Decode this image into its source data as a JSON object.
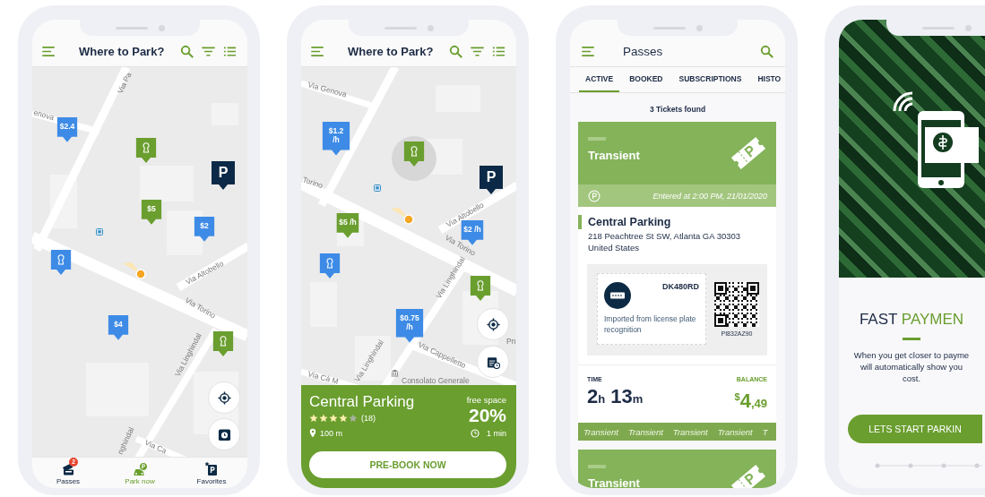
{
  "phones": [
    {
      "kind": "map",
      "header": {
        "title": "Where to Park?"
      },
      "map": {
        "streets": [
          "Via Pa",
          "enova",
          "Via Altobello",
          "Via Torino",
          "Via Linghindal",
          "nghindal",
          "Via Ca"
        ],
        "pins": [
          {
            "kind": "price",
            "label": "$2.4",
            "color": "#3d8be6",
            "selected": false
          },
          {
            "kind": "lock",
            "color": "#6a9e2f",
            "selected": false
          },
          {
            "kind": "parking",
            "label": "P",
            "color": "#0c2a47",
            "selected": false
          },
          {
            "kind": "price",
            "label": "$5",
            "color": "#6a9e2f",
            "selected": false
          },
          {
            "kind": "price",
            "label": "$2",
            "color": "#3d8be6",
            "selected": false
          },
          {
            "kind": "lock",
            "color": "#3d8be6",
            "selected": false
          },
          {
            "kind": "price",
            "label": "$4",
            "color": "#3d8be6",
            "selected": false
          },
          {
            "kind": "lock",
            "color": "#6a9e2f",
            "selected": false
          }
        ]
      },
      "nav": [
        {
          "label": "Passes",
          "badge": "2",
          "selected": false
        },
        {
          "label": "Park now",
          "selected": true
        },
        {
          "label": "Favorites",
          "selected": false
        }
      ]
    },
    {
      "kind": "map",
      "header": {
        "title": "Where to Park?"
      },
      "map": {
        "streets": [
          "Via Genova",
          "Torino",
          "Via Altobello",
          "Via Torino",
          "Via Linghindal",
          "Via Linghindal",
          "Via Cappelletto",
          "Via Cà M",
          "Consolato Generale",
          "Pn"
        ],
        "pins": [
          {
            "kind": "price",
            "label": "$1.2 /h",
            "color": "#3d8be6",
            "selected": false
          },
          {
            "kind": "lock",
            "color": "#6a9e2f",
            "selected": true
          },
          {
            "kind": "parking",
            "label": "P",
            "color": "#0c2a47",
            "selected": false
          },
          {
            "kind": "price",
            "label": "$5 /h",
            "color": "#6a9e2f",
            "selected": false
          },
          {
            "kind": "price",
            "label": "$2 /h",
            "color": "#3d8be6",
            "selected": false
          },
          {
            "kind": "lock",
            "color": "#3d8be6",
            "selected": false
          },
          {
            "kind": "lock",
            "color": "#6a9e2f",
            "selected": false
          },
          {
            "kind": "price",
            "label": "$0.75 /h",
            "color": "#3d8be6",
            "selected": false
          }
        ]
      },
      "card": {
        "name": "Central Parking",
        "stars": 4,
        "reviews": "(18)",
        "distance": "100 m",
        "space_label": "free space",
        "space": "20%",
        "eta": "1 min",
        "button": "PRE-BOOK NOW"
      }
    },
    {
      "kind": "passes",
      "header": {
        "title": "Passes"
      },
      "tabs": [
        {
          "label": "ACTIVE",
          "selected": true
        },
        {
          "label": "BOOKED",
          "selected": false
        },
        {
          "label": "SUBSCRIPTIONS",
          "selected": false
        },
        {
          "label": "HISTO",
          "selected": false
        }
      ],
      "count": "3 Tickets found",
      "tickets": [
        {
          "title": "Transient",
          "entered": "Entered at 2:00 PM, 21/01/2020",
          "location": "Central Parking",
          "address_lines": [
            "218 Peachtree St SW, Atlanta GA 30303",
            "United States"
          ],
          "plate": "DK480RD",
          "plate_note": "Imported from license plate recognition",
          "code": "PI832AZ90",
          "time_label": "TIME",
          "time": [
            {
              "value": "2",
              "unit": "h"
            },
            {
              "value": "13",
              "unit": "m"
            }
          ],
          "balance_label": "BALANCE",
          "balance": {
            "currency": "$",
            "amount": "4",
            "cents": ",49"
          },
          "strip": [
            "Transient",
            "Transient",
            "Transient",
            "Transient",
            "T"
          ]
        },
        {
          "title": "Transient"
        }
      ]
    },
    {
      "kind": "onboarding",
      "title": [
        {
          "text": "FAST",
          "accent": false
        },
        {
          "text": "PAYMEN",
          "accent": true
        }
      ],
      "text_lines": [
        "When you get closer to payme",
        "will automatically show you",
        "cost."
      ],
      "button": "LETS START PARKIN"
    }
  ]
}
